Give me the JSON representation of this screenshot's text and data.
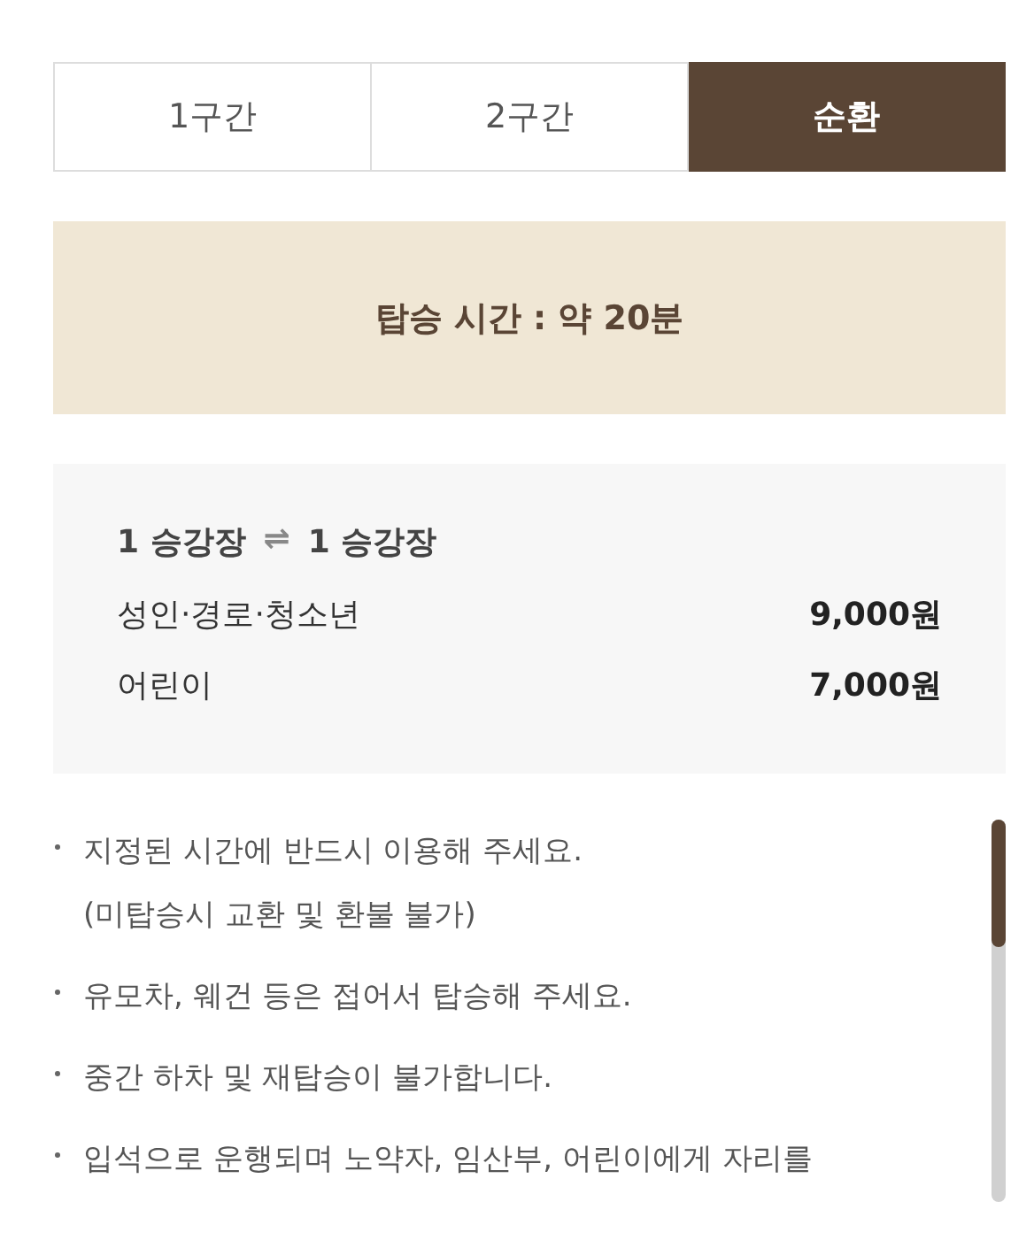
{
  "tabs": [
    {
      "label": "1구간",
      "selected": false
    },
    {
      "label": "2구간",
      "selected": false
    },
    {
      "label": "순환",
      "selected": true
    }
  ],
  "boarding_time": {
    "label": "탑승 시간 : 약 20분"
  },
  "fares": {
    "from": "1 승강장",
    "arrow": "⇌",
    "to": "1 승강장",
    "rows": [
      {
        "category": "성인·경로·청소년",
        "price": "9,000원"
      },
      {
        "category": "어린이",
        "price": "7,000원"
      }
    ]
  },
  "notes": [
    {
      "lines": [
        "지정된 시간에 반드시 이용해 주세요.",
        "(미탑승시 교환 및 환불 불가)"
      ]
    },
    {
      "lines": [
        "유모차, 웨건 등은 접어서 탑승해 주세요."
      ]
    },
    {
      "lines": [
        "중간 하차 및 재탑승이 불가합니다."
      ]
    },
    {
      "lines": [
        "입석으로 운행되며 노약자, 임산부, 어린이에게 자리를"
      ]
    }
  ]
}
